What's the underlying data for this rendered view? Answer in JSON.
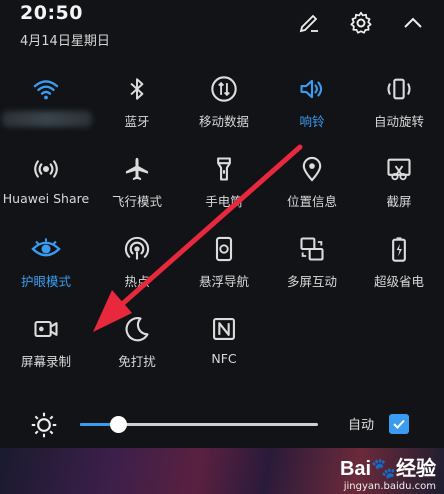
{
  "status": {
    "time": "20:50",
    "date": "4月14日星期日"
  },
  "top_controls": {
    "edit": "edit-icon",
    "settings": "gear-icon",
    "collapse": "chevron-up-icon"
  },
  "tiles": [
    {
      "label": "",
      "icon": "wifi-icon",
      "active": true
    },
    {
      "label": "蓝牙",
      "icon": "bluetooth-icon",
      "active": false
    },
    {
      "label": "移动数据",
      "icon": "mobile-data-icon",
      "active": false
    },
    {
      "label": "响铃",
      "icon": "volume-icon",
      "active": true
    },
    {
      "label": "自动旋转",
      "icon": "rotate-icon",
      "active": false
    },
    {
      "label": "Huawei Share",
      "icon": "huawei-share-icon",
      "active": false
    },
    {
      "label": "飞行模式",
      "icon": "airplane-icon",
      "active": false
    },
    {
      "label": "手电筒",
      "icon": "flashlight-icon",
      "active": false
    },
    {
      "label": "位置信息",
      "icon": "location-icon",
      "active": false
    },
    {
      "label": "截屏",
      "icon": "screenshot-icon",
      "active": false
    },
    {
      "label": "护眼模式",
      "icon": "eye-icon",
      "active": true
    },
    {
      "label": "热点",
      "icon": "hotspot-icon",
      "active": false
    },
    {
      "label": "悬浮导航",
      "icon": "floating-nav-icon",
      "active": false
    },
    {
      "label": "多屏互动",
      "icon": "multi-screen-icon",
      "active": false
    },
    {
      "label": "超级省电",
      "icon": "battery-saver-icon",
      "active": false
    },
    {
      "label": "屏幕录制",
      "icon": "screen-record-icon",
      "active": false
    },
    {
      "label": "免打扰",
      "icon": "moon-icon",
      "active": false
    },
    {
      "label": "NFC",
      "icon": "nfc-icon",
      "active": false
    }
  ],
  "brightness": {
    "level": 0.16,
    "auto_label": "自动",
    "auto_checked": true
  },
  "colors": {
    "accent": "#3a9cf0",
    "arrow": "#e8283c",
    "background": "#111316"
  },
  "watermark": {
    "logo_a": "Bai",
    "logo_b": "经验",
    "site": "jingyan.baidu.com"
  }
}
